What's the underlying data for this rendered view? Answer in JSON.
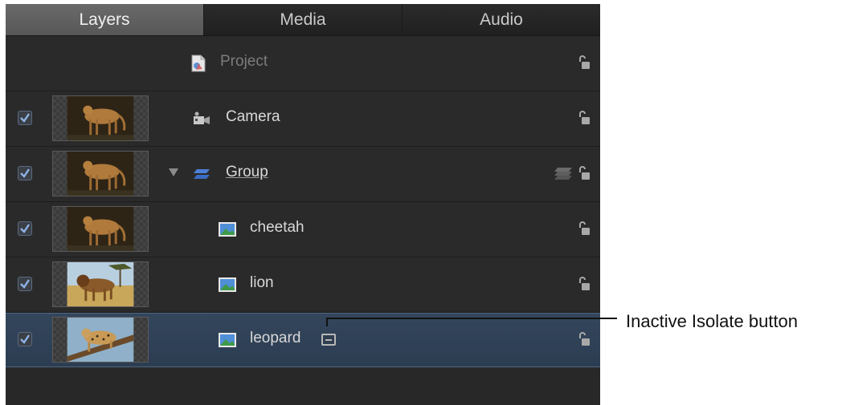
{
  "tabs": [
    {
      "label": "Layers",
      "active": true
    },
    {
      "label": "Media",
      "active": false
    },
    {
      "label": "Audio",
      "active": false
    }
  ],
  "layers": [
    {
      "name": "Project",
      "icon": "project-icon",
      "checked": null,
      "thumbnail": null,
      "locked": false,
      "dimmed": true
    },
    {
      "name": "Camera",
      "icon": "camera-icon",
      "checked": true,
      "thumbnail": "cheetah",
      "locked": false
    },
    {
      "name": "Group",
      "icon": "group-icon",
      "checked": true,
      "thumbnail": "cheetah",
      "expanded": true,
      "locked": false
    },
    {
      "name": "cheetah",
      "icon": "image-icon",
      "checked": true,
      "thumbnail": "cheetah",
      "locked": false
    },
    {
      "name": "lion",
      "icon": "image-icon",
      "checked": true,
      "thumbnail": "lion",
      "locked": false
    },
    {
      "name": "leopard",
      "icon": "image-icon",
      "checked": true,
      "thumbnail": "leopard",
      "locked": false,
      "selected": true,
      "isolate_button": "inactive"
    }
  ],
  "callout": {
    "label": "Inactive Isolate button"
  },
  "colors": {
    "panel_bg": "#282828",
    "selected_row": "#34465c",
    "tab_active": "#616161",
    "checkbox_check": "#8fb4e8"
  }
}
